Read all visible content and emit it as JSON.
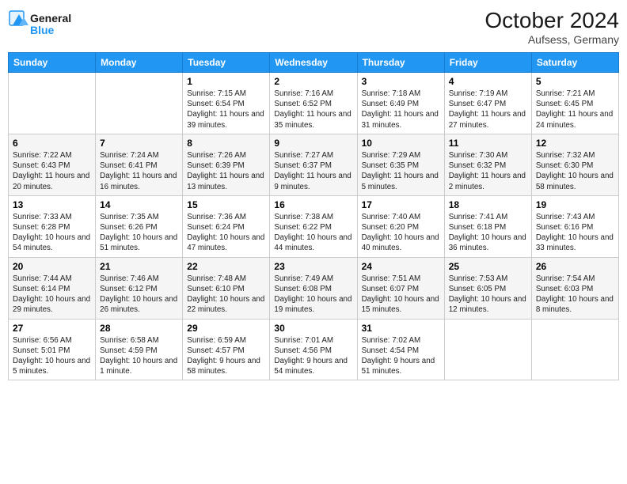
{
  "header": {
    "logo_line1": "General",
    "logo_line2": "Blue",
    "month": "October 2024",
    "location": "Aufsess, Germany"
  },
  "days_of_week": [
    "Sunday",
    "Monday",
    "Tuesday",
    "Wednesday",
    "Thursday",
    "Friday",
    "Saturday"
  ],
  "weeks": [
    [
      {
        "day": "",
        "info": ""
      },
      {
        "day": "",
        "info": ""
      },
      {
        "day": "1",
        "info": "Sunrise: 7:15 AM\nSunset: 6:54 PM\nDaylight: 11 hours and 39 minutes."
      },
      {
        "day": "2",
        "info": "Sunrise: 7:16 AM\nSunset: 6:52 PM\nDaylight: 11 hours and 35 minutes."
      },
      {
        "day": "3",
        "info": "Sunrise: 7:18 AM\nSunset: 6:49 PM\nDaylight: 11 hours and 31 minutes."
      },
      {
        "day": "4",
        "info": "Sunrise: 7:19 AM\nSunset: 6:47 PM\nDaylight: 11 hours and 27 minutes."
      },
      {
        "day": "5",
        "info": "Sunrise: 7:21 AM\nSunset: 6:45 PM\nDaylight: 11 hours and 24 minutes."
      }
    ],
    [
      {
        "day": "6",
        "info": "Sunrise: 7:22 AM\nSunset: 6:43 PM\nDaylight: 11 hours and 20 minutes."
      },
      {
        "day": "7",
        "info": "Sunrise: 7:24 AM\nSunset: 6:41 PM\nDaylight: 11 hours and 16 minutes."
      },
      {
        "day": "8",
        "info": "Sunrise: 7:26 AM\nSunset: 6:39 PM\nDaylight: 11 hours and 13 minutes."
      },
      {
        "day": "9",
        "info": "Sunrise: 7:27 AM\nSunset: 6:37 PM\nDaylight: 11 hours and 9 minutes."
      },
      {
        "day": "10",
        "info": "Sunrise: 7:29 AM\nSunset: 6:35 PM\nDaylight: 11 hours and 5 minutes."
      },
      {
        "day": "11",
        "info": "Sunrise: 7:30 AM\nSunset: 6:32 PM\nDaylight: 11 hours and 2 minutes."
      },
      {
        "day": "12",
        "info": "Sunrise: 7:32 AM\nSunset: 6:30 PM\nDaylight: 10 hours and 58 minutes."
      }
    ],
    [
      {
        "day": "13",
        "info": "Sunrise: 7:33 AM\nSunset: 6:28 PM\nDaylight: 10 hours and 54 minutes."
      },
      {
        "day": "14",
        "info": "Sunrise: 7:35 AM\nSunset: 6:26 PM\nDaylight: 10 hours and 51 minutes."
      },
      {
        "day": "15",
        "info": "Sunrise: 7:36 AM\nSunset: 6:24 PM\nDaylight: 10 hours and 47 minutes."
      },
      {
        "day": "16",
        "info": "Sunrise: 7:38 AM\nSunset: 6:22 PM\nDaylight: 10 hours and 44 minutes."
      },
      {
        "day": "17",
        "info": "Sunrise: 7:40 AM\nSunset: 6:20 PM\nDaylight: 10 hours and 40 minutes."
      },
      {
        "day": "18",
        "info": "Sunrise: 7:41 AM\nSunset: 6:18 PM\nDaylight: 10 hours and 36 minutes."
      },
      {
        "day": "19",
        "info": "Sunrise: 7:43 AM\nSunset: 6:16 PM\nDaylight: 10 hours and 33 minutes."
      }
    ],
    [
      {
        "day": "20",
        "info": "Sunrise: 7:44 AM\nSunset: 6:14 PM\nDaylight: 10 hours and 29 minutes."
      },
      {
        "day": "21",
        "info": "Sunrise: 7:46 AM\nSunset: 6:12 PM\nDaylight: 10 hours and 26 minutes."
      },
      {
        "day": "22",
        "info": "Sunrise: 7:48 AM\nSunset: 6:10 PM\nDaylight: 10 hours and 22 minutes."
      },
      {
        "day": "23",
        "info": "Sunrise: 7:49 AM\nSunset: 6:08 PM\nDaylight: 10 hours and 19 minutes."
      },
      {
        "day": "24",
        "info": "Sunrise: 7:51 AM\nSunset: 6:07 PM\nDaylight: 10 hours and 15 minutes."
      },
      {
        "day": "25",
        "info": "Sunrise: 7:53 AM\nSunset: 6:05 PM\nDaylight: 10 hours and 12 minutes."
      },
      {
        "day": "26",
        "info": "Sunrise: 7:54 AM\nSunset: 6:03 PM\nDaylight: 10 hours and 8 minutes."
      }
    ],
    [
      {
        "day": "27",
        "info": "Sunrise: 6:56 AM\nSunset: 5:01 PM\nDaylight: 10 hours and 5 minutes."
      },
      {
        "day": "28",
        "info": "Sunrise: 6:58 AM\nSunset: 4:59 PM\nDaylight: 10 hours and 1 minute."
      },
      {
        "day": "29",
        "info": "Sunrise: 6:59 AM\nSunset: 4:57 PM\nDaylight: 9 hours and 58 minutes."
      },
      {
        "day": "30",
        "info": "Sunrise: 7:01 AM\nSunset: 4:56 PM\nDaylight: 9 hours and 54 minutes."
      },
      {
        "day": "31",
        "info": "Sunrise: 7:02 AM\nSunset: 4:54 PM\nDaylight: 9 hours and 51 minutes."
      },
      {
        "day": "",
        "info": ""
      },
      {
        "day": "",
        "info": ""
      }
    ]
  ]
}
